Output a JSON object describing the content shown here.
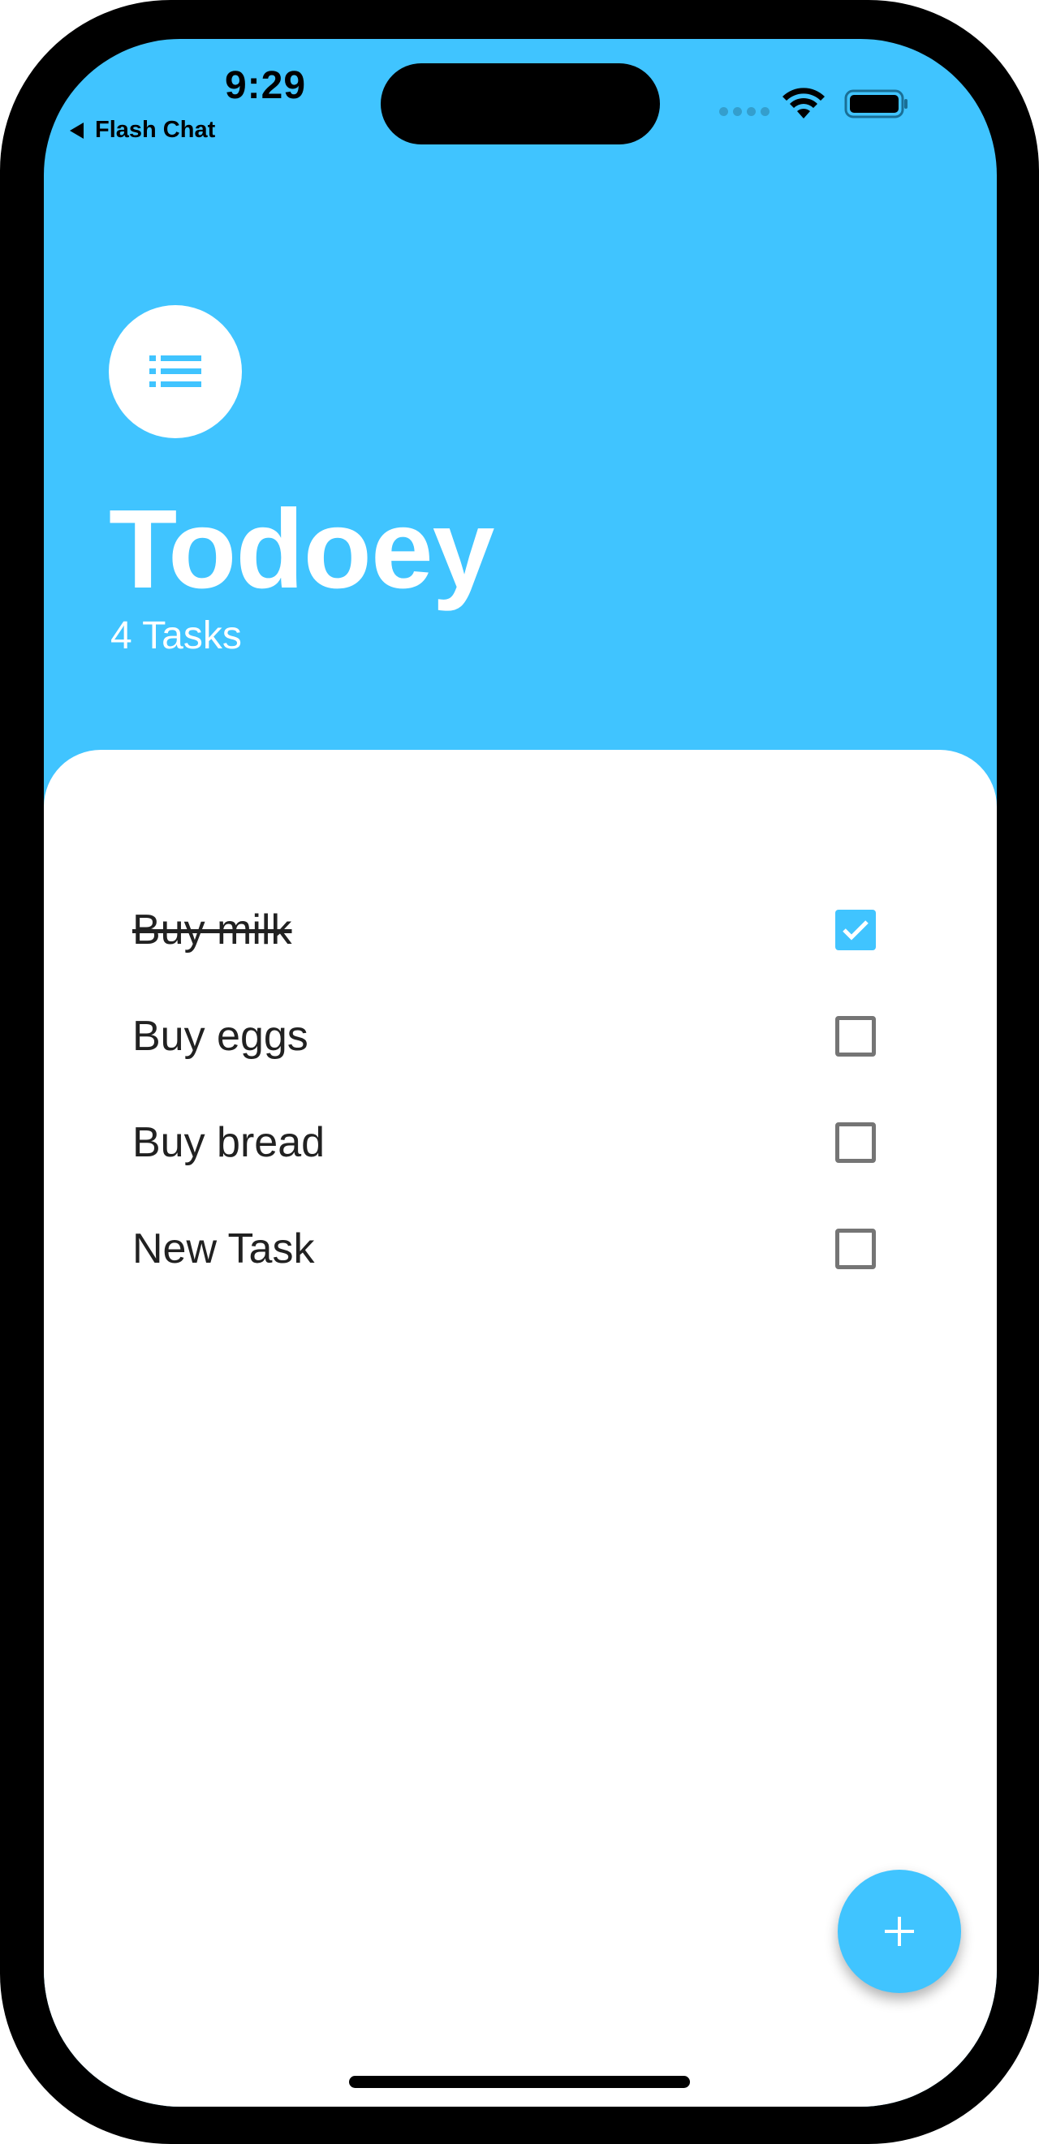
{
  "status_bar": {
    "time": "9:29",
    "back_app_label": "Flash Chat",
    "icons": [
      "signal-dots-icon",
      "wifi-icon",
      "battery-icon"
    ]
  },
  "header": {
    "icon": "list-icon",
    "title": "Todoey",
    "task_count": "4 Tasks"
  },
  "tasks": [
    {
      "label": "Buy milk",
      "done": true
    },
    {
      "label": "Buy eggs",
      "done": false
    },
    {
      "label": "Buy bread",
      "done": false
    },
    {
      "label": "New Task",
      "done": false
    }
  ],
  "fab": {
    "icon": "plus-icon"
  },
  "colors": {
    "accent": "#40C4FF",
    "text": "#212121",
    "checkbox_border": "#757575",
    "background": "#FFFFFF"
  }
}
